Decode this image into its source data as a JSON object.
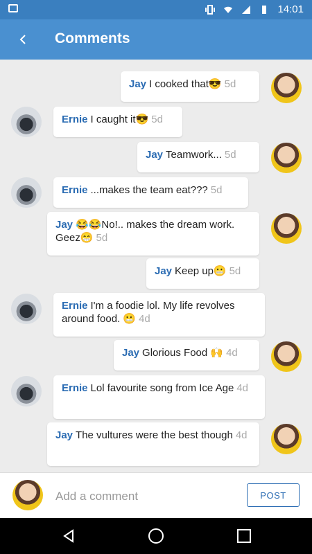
{
  "status_bar": {
    "time": "14:01"
  },
  "header": {
    "title": "Comments"
  },
  "comments": [
    {
      "author": "Jay",
      "text": "I cooked that😎",
      "age": "5d"
    },
    {
      "author": "Ernie",
      "text": "I caught it😎",
      "age": "5d"
    },
    {
      "author": "Jay",
      "text": "Teamwork...",
      "age": "5d"
    },
    {
      "author": "Ernie",
      "text": "...makes the team eat???",
      "age": "5d"
    },
    {
      "author": "Jay",
      "text": "😂😂No!.. makes the dream work. Geez😁",
      "age": "5d"
    },
    {
      "author": "Jay",
      "text": "Keep up😬",
      "age": "5d"
    },
    {
      "author": "Ernie",
      "text": "I'm a foodie lol. My life revolves around food. 😬",
      "age": "4d"
    },
    {
      "author": "Jay",
      "text": "Glorious Food 🙌",
      "age": "4d"
    },
    {
      "author": "Ernie",
      "text": "Lol favourite song from Ice Age",
      "age": "4d"
    },
    {
      "author": "Jay",
      "text": "The vultures were the best though",
      "age": "4d"
    }
  ],
  "composer": {
    "placeholder": "Add a comment",
    "post_label": "POST"
  },
  "icons": {
    "back": "arrow-left",
    "status_left": "image",
    "status_vibrate": "vibrate",
    "status_wifi": "wifi",
    "status_signal": "signal",
    "status_battery": "battery"
  }
}
